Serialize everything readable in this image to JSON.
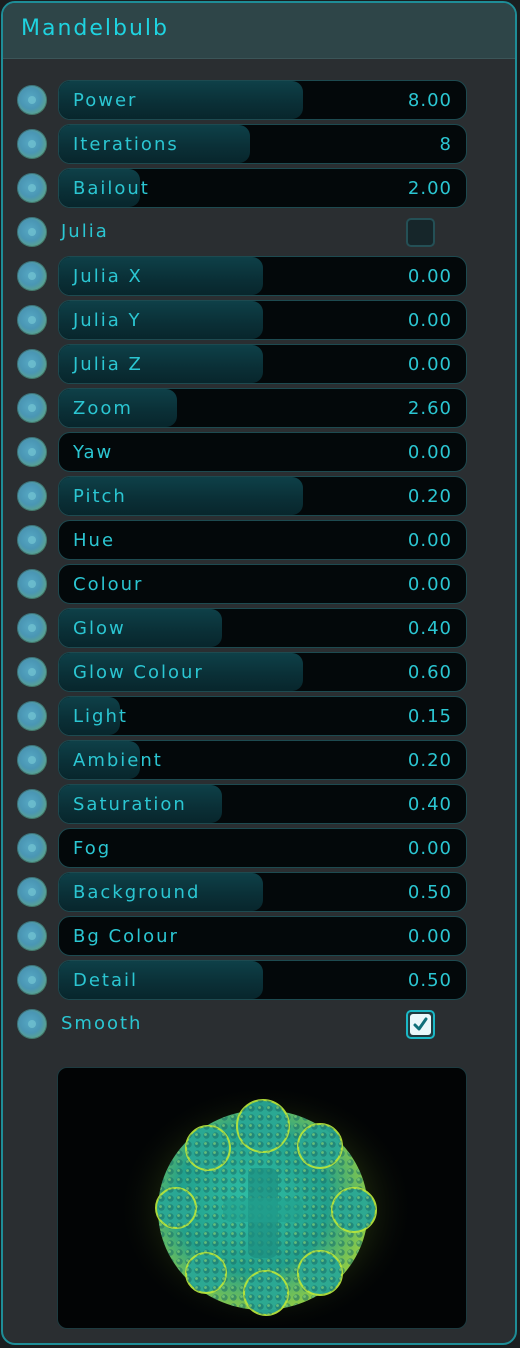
{
  "title": "Mandelbulb",
  "params": [
    {
      "label": "Power",
      "value": "8.00",
      "fraction": 0.6
    },
    {
      "label": "Iterations",
      "value": "8",
      "fraction": 0.47
    },
    {
      "label": "Bailout",
      "value": "2.00",
      "fraction": 0.2
    },
    {
      "label": "Julia X",
      "value": "0.00",
      "fraction": 0.5
    },
    {
      "label": "Julia Y",
      "value": "0.00",
      "fraction": 0.5
    },
    {
      "label": "Julia Z",
      "value": "0.00",
      "fraction": 0.5
    },
    {
      "label": "Zoom",
      "value": "2.60",
      "fraction": 0.29
    },
    {
      "label": "Yaw",
      "value": "0.00",
      "fraction": 0.0
    },
    {
      "label": "Pitch",
      "value": "0.20",
      "fraction": 0.6
    },
    {
      "label": "Hue",
      "value": "0.00",
      "fraction": 0.0
    },
    {
      "label": "Colour",
      "value": "0.00",
      "fraction": 0.0
    },
    {
      "label": "Glow",
      "value": "0.40",
      "fraction": 0.4
    },
    {
      "label": "Glow Colour",
      "value": "0.60",
      "fraction": 0.6
    },
    {
      "label": "Light",
      "value": "0.15",
      "fraction": 0.15
    },
    {
      "label": "Ambient",
      "value": "0.20",
      "fraction": 0.2
    },
    {
      "label": "Saturation",
      "value": "0.40",
      "fraction": 0.4
    },
    {
      "label": "Fog",
      "value": "0.00",
      "fraction": 0.0
    },
    {
      "label": "Background",
      "value": "0.50",
      "fraction": 0.5
    },
    {
      "label": "Bg Colour",
      "value": "0.00",
      "fraction": 0.0
    },
    {
      "label": "Detail",
      "value": "0.50",
      "fraction": 0.5
    }
  ],
  "toggles": {
    "julia": {
      "label": "Julia",
      "checked": false
    },
    "smooth": {
      "label": "Smooth",
      "checked": true
    }
  },
  "colors": {
    "accent": "#1fd3e0",
    "border": "#1e8d97",
    "fractal_main": "#28b3a0",
    "fractal_glow": "#b8e23a"
  }
}
